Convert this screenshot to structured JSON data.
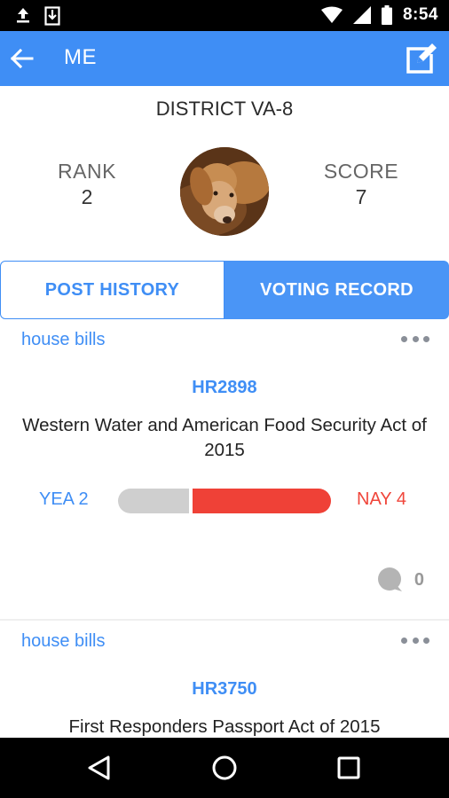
{
  "status_bar": {
    "time": "8:54",
    "icons": [
      "upload-icon",
      "download-icon",
      "wifi-icon",
      "cell-signal-icon",
      "battery-icon"
    ]
  },
  "app_bar": {
    "title": "ME",
    "back_icon": "arrow-left-icon",
    "edit_icon": "edit-icon",
    "color": "#3f8ef5"
  },
  "profile": {
    "district": "DISTRICT VA-8",
    "rank_label": "RANK",
    "rank_value": "2",
    "score_label": "SCORE",
    "score_value": "7"
  },
  "tabs": [
    {
      "label": "POST HISTORY",
      "active": false
    },
    {
      "label": "VOTING RECORD",
      "active": true
    }
  ],
  "feed": [
    {
      "category": "house bills",
      "bill_id": "HR2898",
      "bill_name": "Western Water and American Food Security Act of 2015",
      "yea_label": "YEA 2",
      "nay_label": "NAY 4",
      "yea": 2,
      "nay": 4,
      "comment_count": "0"
    },
    {
      "category": "house bills",
      "bill_id": "HR3750",
      "bill_name": "First Responders Passport Act of 2015"
    }
  ],
  "colors": {
    "accent": "#3f8ef5",
    "nay": "#ef4137",
    "yea_bar": "#cfcfcf"
  },
  "nav_bar": {
    "icons": [
      "nav-back-icon",
      "nav-home-icon",
      "nav-recents-icon"
    ]
  }
}
